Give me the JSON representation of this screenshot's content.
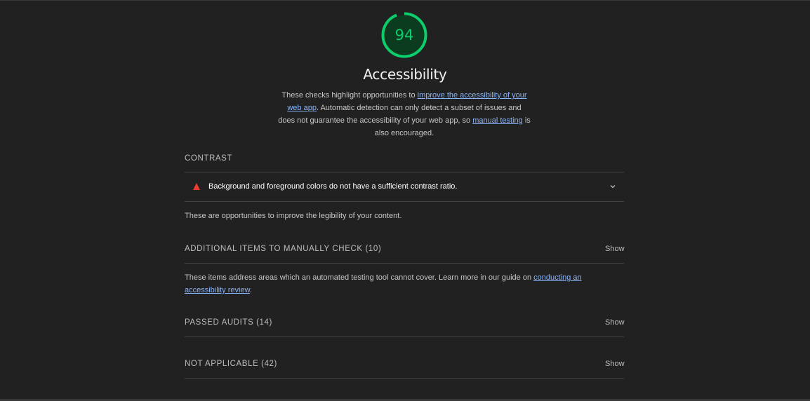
{
  "gauge": {
    "score": "94",
    "fraction": 0.94,
    "color": "#0cce6b",
    "track_color": "#0c3c1f"
  },
  "category": {
    "title": "Accessibility",
    "desc_part1": "These checks highlight opportunities to ",
    "desc_link1": "improve the accessibility of your web app",
    "desc_part2": ". Automatic detection can only detect a subset of issues and does not guarantee the accessibility of your web app, so ",
    "desc_link2": "manual testing",
    "desc_part3": " is also encouraged."
  },
  "contrast": {
    "title": "CONTRAST",
    "audit_title": "Background and foreground colors do not have a sufficient contrast ratio.",
    "audit_icon": "warning-triangle-icon",
    "fail_color": "#eb3d2f",
    "description": "These are opportunities to improve the legibility of your content."
  },
  "manual": {
    "title": "ADDITIONAL ITEMS TO MANUALLY CHECK (10)",
    "show_label": "Show",
    "desc_part1": "These items address areas which an automated testing tool cannot cover. Learn more in our guide on ",
    "desc_link": "conducting an accessibility review",
    "desc_part2": "."
  },
  "passed": {
    "title": "PASSED AUDITS (14)",
    "show_label": "Show"
  },
  "not_applicable": {
    "title": "NOT APPLICABLE (42)",
    "show_label": "Show"
  }
}
